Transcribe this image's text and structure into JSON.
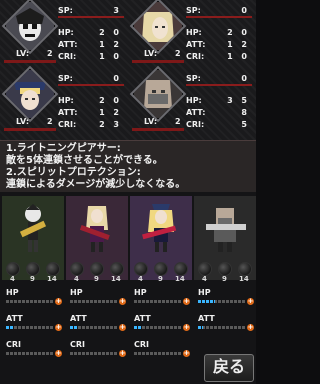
{
  "top": {
    "characters": [
      {
        "sp": "3",
        "hp": "2 0",
        "att": "1 2",
        "cri": "1 0",
        "lv": "2"
      },
      {
        "sp": "0",
        "hp": "2 0",
        "att": "1 2",
        "cri": "1 0",
        "lv": "2"
      },
      {
        "sp": "0",
        "hp": "2 0",
        "att": "1 2",
        "cri": "2 3",
        "lv": "2"
      },
      {
        "sp": "0",
        "hp": "3 5",
        "att": "8",
        "cri": "5",
        "lv": "2"
      }
    ],
    "labels": {
      "sp": "SP:",
      "hp": "HP:",
      "att": "ATT:",
      "cri": "CRI:",
      "lv": "LV:"
    },
    "description": [
      "1.ライトニングピアサー:",
      "敵を5体連鎖させることができる。",
      "2.スピリットプロテクション:",
      "連鎖によるダメージが減少しなくなる。"
    ]
  },
  "bottom": {
    "columns": [
      {
        "orbs": [
          "4",
          "9",
          "14"
        ],
        "hp_fill": 0,
        "att_fill": 0.15,
        "cri_fill": 0,
        "bg": "#2c3a2a"
      },
      {
        "orbs": [
          "4",
          "9",
          "14"
        ],
        "hp_fill": 0,
        "att_fill": 0.15,
        "cri_fill": 0,
        "bg": "#3a2a3a"
      },
      {
        "orbs": [
          "4",
          "9",
          "14"
        ],
        "hp_fill": 0,
        "att_fill": 0.15,
        "cri_fill": 0,
        "bg": "#3e2e4a"
      },
      {
        "orbs": [
          "4",
          "9",
          "14"
        ],
        "hp_fill": 0.35,
        "att_fill": 0.1,
        "cri_fill": 0,
        "bg": "#2a2a2a"
      }
    ],
    "stat_labels": {
      "hp": "HP",
      "att": "ATT",
      "cri": "CRI"
    },
    "back_label": "戻る"
  },
  "colors": {
    "accent": "#e06a18",
    "bar_fill": "#3ab6ff",
    "underline": "#7d1818"
  }
}
